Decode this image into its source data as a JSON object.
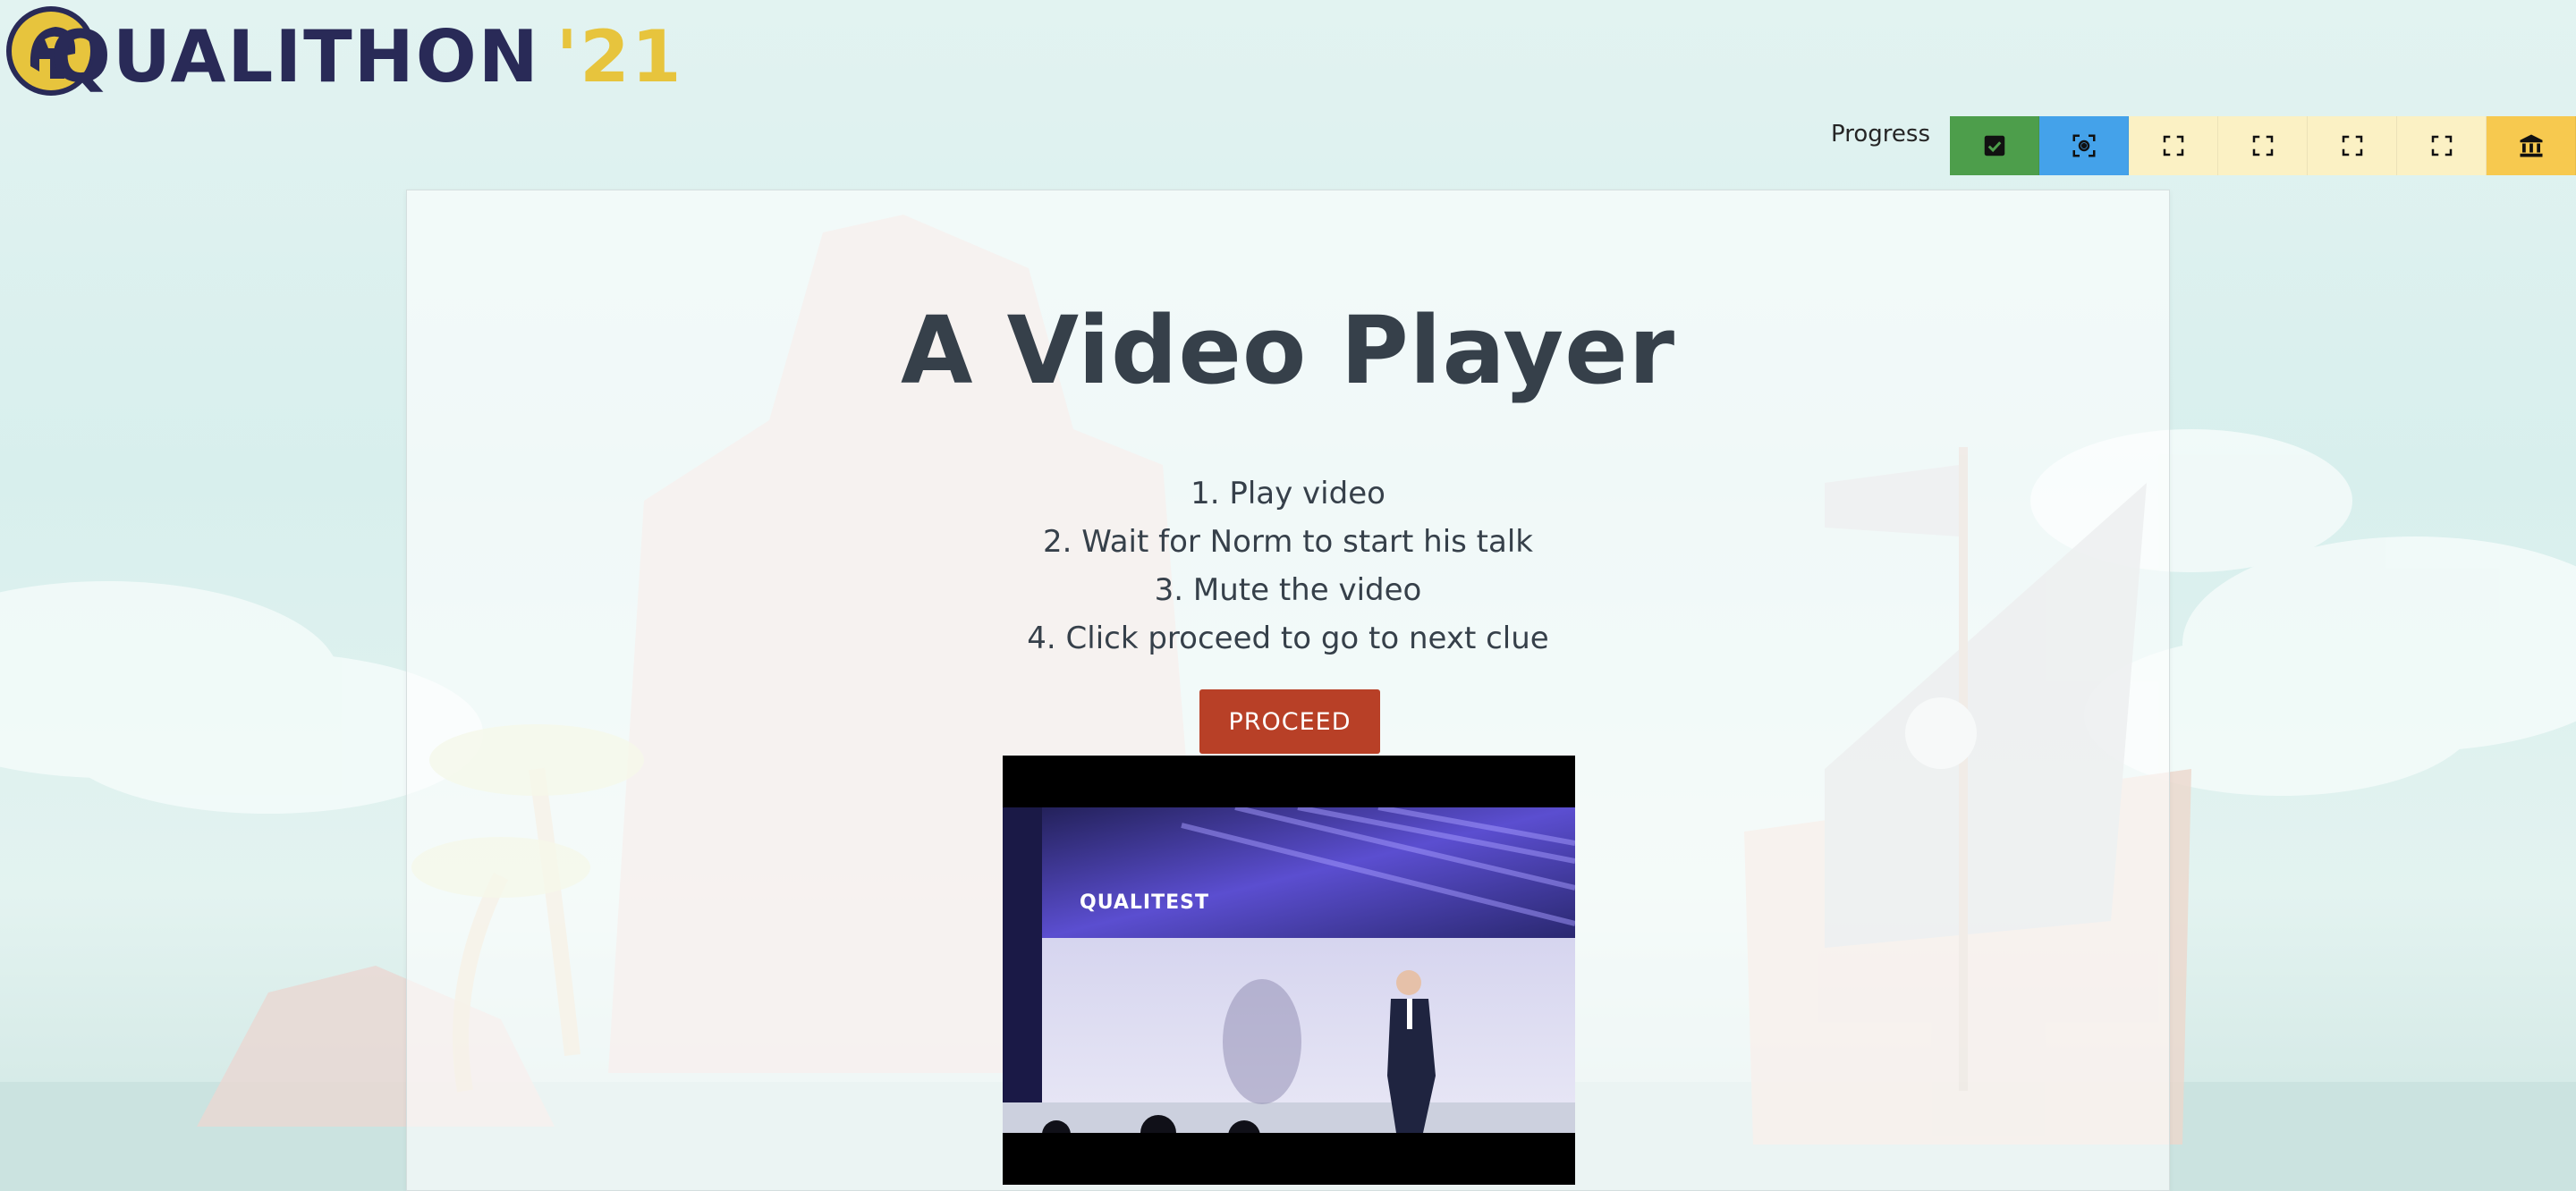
{
  "logo": {
    "name": "QUALITHON",
    "year": "'21"
  },
  "progress": {
    "label": "Progress",
    "steps": [
      {
        "state": "completed",
        "icon": "checkbox-checked-icon",
        "color": "#4d9e4b"
      },
      {
        "state": "current",
        "icon": "focus-camera-icon",
        "color": "#44a2ea"
      },
      {
        "state": "pending",
        "icon": "fullscreen-frame-icon",
        "color": "#fbf1c4"
      },
      {
        "state": "pending",
        "icon": "fullscreen-frame-icon",
        "color": "#fbf1c4"
      },
      {
        "state": "pending",
        "icon": "fullscreen-frame-icon",
        "color": "#fbf1c4"
      },
      {
        "state": "pending",
        "icon": "fullscreen-frame-icon",
        "color": "#fbf1c4"
      },
      {
        "state": "final",
        "icon": "bank-icon",
        "color": "#f7c94f"
      }
    ]
  },
  "main": {
    "title": "A Video Player",
    "steps": [
      "1. Play video",
      "2. Wait for Norm to start his talk",
      "3. Mute the video",
      "4. Click proceed to go to next clue"
    ],
    "proceed_label": "PROCEED"
  },
  "video": {
    "brand_text": "QUALITEST"
  }
}
